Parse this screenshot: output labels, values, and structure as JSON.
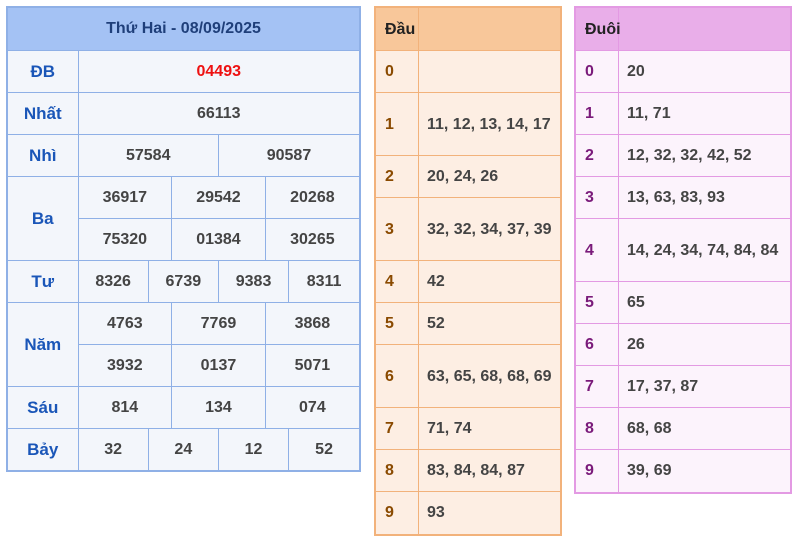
{
  "results": {
    "title": "Thứ Hai - 08/09/2025",
    "rows": {
      "db": {
        "label": "ĐB",
        "values": [
          "04493"
        ]
      },
      "nhat": {
        "label": "Nhất",
        "values": [
          "66113"
        ]
      },
      "nhi": {
        "label": "Nhì",
        "values": [
          "57584",
          "90587"
        ]
      },
      "ba": {
        "label": "Ba",
        "values": [
          "36917",
          "29542",
          "20268",
          "75320",
          "01384",
          "30265"
        ]
      },
      "tu": {
        "label": "Tư",
        "values": [
          "8326",
          "6739",
          "9383",
          "8311"
        ]
      },
      "nam": {
        "label": "Năm",
        "values": [
          "4763",
          "7769",
          "3868",
          "3932",
          "0137",
          "5071"
        ]
      },
      "sau": {
        "label": "Sáu",
        "values": [
          "814",
          "134",
          "074"
        ]
      },
      "bay": {
        "label": "Bảy",
        "values": [
          "32",
          "24",
          "12",
          "52"
        ]
      }
    },
    "special_color": "#ee1111"
  },
  "dau": {
    "title": "Đầu",
    "rows": [
      {
        "key": "0",
        "value": ""
      },
      {
        "key": "1",
        "value": "11, 12, 13, 14, 17"
      },
      {
        "key": "2",
        "value": "20, 24, 26"
      },
      {
        "key": "3",
        "value": "32, 32, 34, 37, 39"
      },
      {
        "key": "4",
        "value": "42"
      },
      {
        "key": "5",
        "value": "52"
      },
      {
        "key": "6",
        "value": "63, 65, 68, 68, 69"
      },
      {
        "key": "7",
        "value": "71, 74"
      },
      {
        "key": "8",
        "value": "83, 84, 84, 87"
      },
      {
        "key": "9",
        "value": "93"
      }
    ]
  },
  "duoi": {
    "title": "Đuôi",
    "rows": [
      {
        "key": "0",
        "value": "20"
      },
      {
        "key": "1",
        "value": "11, 71"
      },
      {
        "key": "2",
        "value": "12, 32, 32, 42, 52"
      },
      {
        "key": "3",
        "value": "13, 63, 83, 93"
      },
      {
        "key": "4",
        "value": "14, 24, 34, 74, 84, 84"
      },
      {
        "key": "5",
        "value": "65"
      },
      {
        "key": "6",
        "value": "26"
      },
      {
        "key": "7",
        "value": "17, 37, 87"
      },
      {
        "key": "8",
        "value": "68, 68"
      },
      {
        "key": "9",
        "value": "39, 69"
      }
    ]
  }
}
